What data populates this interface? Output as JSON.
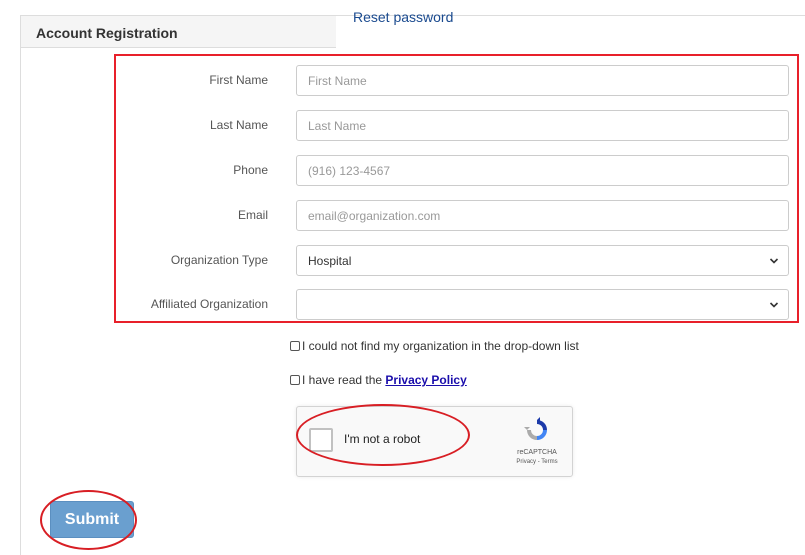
{
  "panel": {
    "title": "Account Registration"
  },
  "reset_link": "Reset password",
  "fields": {
    "first_name": {
      "label": "First Name",
      "placeholder": "First Name"
    },
    "last_name": {
      "label": "Last Name",
      "placeholder": "Last Name"
    },
    "phone": {
      "label": "Phone",
      "placeholder": "(916) 123-4567"
    },
    "email": {
      "label": "Email",
      "placeholder": "email@organization.com"
    },
    "org_type": {
      "label": "Organization Type",
      "value": "Hospital"
    },
    "affiliated_org": {
      "label": "Affiliated Organization",
      "value": ""
    }
  },
  "checkboxes": {
    "not_found": {
      "label": "I could not find my organization in the drop-down list",
      "checked": false
    },
    "privacy": {
      "label_prefix": "I have read the ",
      "link": "Privacy Policy",
      "checked": false
    }
  },
  "recaptcha": {
    "label": "I'm not a robot",
    "brand": "reCAPTCHA",
    "terms": "Privacy - Terms"
  },
  "submit_label": "Submit",
  "colors": {
    "highlight": "#e8202a",
    "submit": "#6a9fcf",
    "link": "#1a4a8f"
  }
}
